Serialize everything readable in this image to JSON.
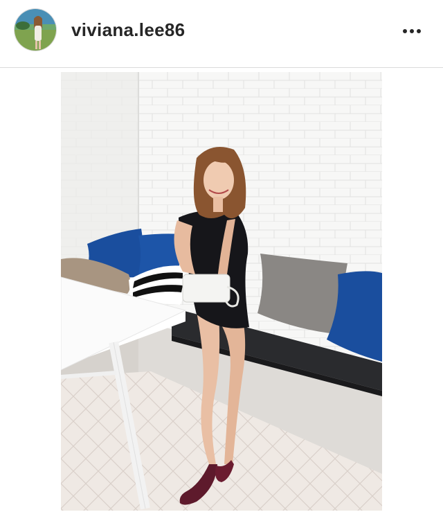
{
  "post": {
    "username": "viviana.lee86",
    "more_icon": "more-horizontal-icon",
    "avatar_icon": "profile-avatar",
    "photo_description_icon": "post-photo"
  },
  "colors": {
    "text": "#262626",
    "divider": "#dbdbdb",
    "dress": "#16161a",
    "pillow_blue": "#1a4e9e",
    "pillow_gray": "#8a8784"
  }
}
